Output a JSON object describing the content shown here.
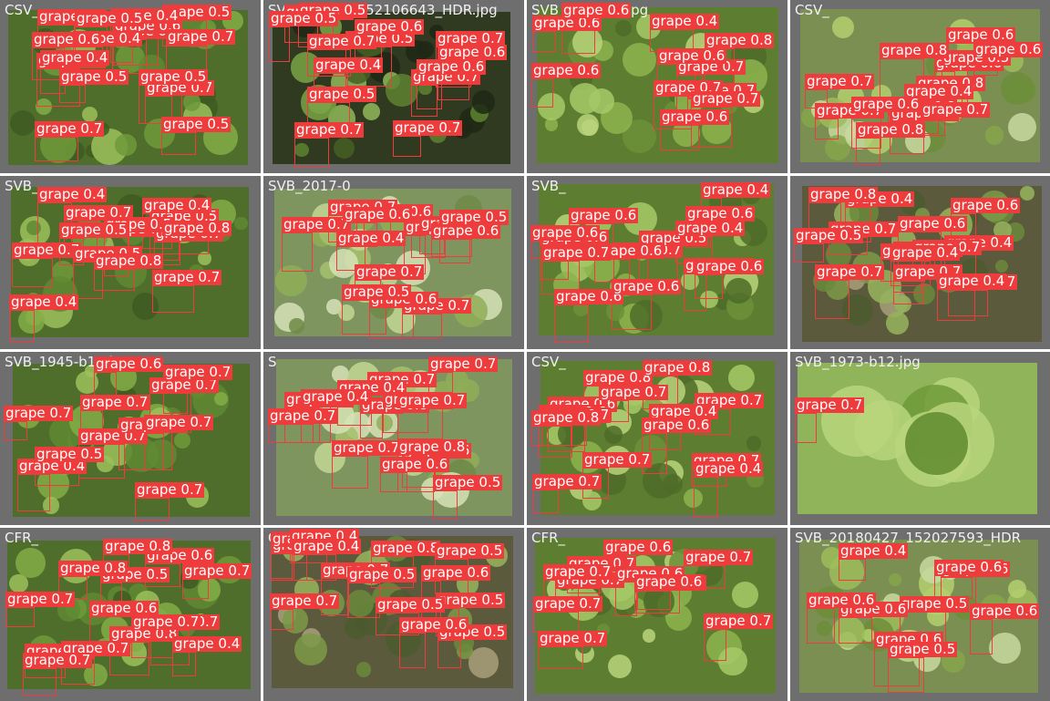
{
  "image": {
    "kind": "object-detection-mosaic",
    "class_name": "grape"
  },
  "palette": {
    "box": "#ee3b3b",
    "tag_text": "#ffffff",
    "tile_bg": "#6e6e6e",
    "file_label": "#f0f0f0"
  },
  "tiles": [
    {
      "file": "CSV_",
      "scene": "leaf-grapes",
      "detections": [
        {
          "label": "grape",
          "conf": "0.5"
        },
        {
          "label": "grape",
          "conf": "0.7"
        },
        {
          "label": "grape",
          "conf": "0.7"
        },
        {
          "label": "grape",
          "conf": "0.6"
        },
        {
          "label": "grape",
          "conf": "0.8"
        },
        {
          "label": "grape",
          "conf": "0.4"
        },
        {
          "label": "grape",
          "conf": "0.7"
        },
        {
          "label": "grape",
          "conf": "0.5"
        },
        {
          "label": "grape",
          "conf": "0.4"
        },
        {
          "label": "grape",
          "conf": "0.7"
        },
        {
          "label": "grape",
          "conf": "0.5"
        },
        {
          "label": "grape",
          "conf": "0.7"
        },
        {
          "label": "grape",
          "conf": "0.4"
        },
        {
          "label": "grape",
          "conf": "0.6"
        },
        {
          "label": "grape",
          "conf": "0.5"
        },
        {
          "label": "grape",
          "conf": "0.5"
        }
      ]
    },
    {
      "file": "SVB_2018..._152106643_HDR.jpg",
      "scene": "dark-vine",
      "detections": [
        {
          "label": "grape",
          "conf": "0.5"
        },
        {
          "label": "grape",
          "conf": "0.4"
        },
        {
          "label": "grape",
          "conf": "0.7"
        },
        {
          "label": "grape",
          "conf": "0.7"
        },
        {
          "label": "grape",
          "conf": "0.6"
        },
        {
          "label": "grape",
          "conf": "0.5"
        },
        {
          "label": "grape",
          "conf": "0.7"
        },
        {
          "label": "grape",
          "conf": "0.6"
        },
        {
          "label": "grape",
          "conf": "0.6"
        },
        {
          "label": "grape",
          "conf": "0.7"
        },
        {
          "label": "grape",
          "conf": "0.7"
        },
        {
          "label": "grape",
          "conf": "0.5"
        },
        {
          "label": "grape",
          "conf": "0.7"
        },
        {
          "label": "grape",
          "conf": "0.5"
        }
      ]
    },
    {
      "file": "SVB_1949-b6.jpg",
      "scene": "green-cluster",
      "detections": [
        {
          "label": "grape",
          "conf": "0.6"
        },
        {
          "label": "grape",
          "conf": "0.7"
        },
        {
          "label": "grape",
          "conf": "0.6"
        },
        {
          "label": "grape",
          "conf": "0.7"
        },
        {
          "label": "grape",
          "conf": "0.6"
        },
        {
          "label": "grape",
          "conf": "0.7"
        },
        {
          "label": "grape",
          "conf": "0.7"
        },
        {
          "label": "grape",
          "conf": "0.4"
        },
        {
          "label": "grape",
          "conf": "0.6"
        },
        {
          "label": "grape",
          "conf": "0.8"
        },
        {
          "label": "grape",
          "conf": "0.6"
        }
      ]
    },
    {
      "file": "CSV_",
      "scene": "dense-bunch",
      "detections": [
        {
          "label": "grape",
          "conf": "0.8"
        },
        {
          "label": "grape",
          "conf": "0.7"
        },
        {
          "label": "grape",
          "conf": "0.6"
        },
        {
          "label": "grape",
          "conf": "0.6"
        },
        {
          "label": "grape",
          "conf": "0.7"
        },
        {
          "label": "grape",
          "conf": "0.8"
        },
        {
          "label": "grape",
          "conf": "0.5"
        },
        {
          "label": "grape",
          "conf": "0.4"
        },
        {
          "label": "grape",
          "conf": "0.8"
        },
        {
          "label": "grape",
          "conf": "0.6"
        },
        {
          "label": "grape",
          "conf": "0.7"
        },
        {
          "label": "grape",
          "conf": "0.8"
        },
        {
          "label": "grape",
          "conf": "0.6"
        },
        {
          "label": "grape",
          "conf": "0.7"
        }
      ]
    },
    {
      "file": "SVB_",
      "scene": "leaf-grapes",
      "detections": [
        {
          "label": "grape",
          "conf": "0.4"
        },
        {
          "label": "grape",
          "conf": "0.4"
        },
        {
          "label": "grape",
          "conf": "0.5"
        },
        {
          "label": "grape",
          "conf": "0.4"
        },
        {
          "label": "grape",
          "conf": "0.7"
        },
        {
          "label": "grape",
          "conf": "0.7"
        },
        {
          "label": "grape",
          "conf": "0.7"
        },
        {
          "label": "grape",
          "conf": "0.5"
        },
        {
          "label": "grape",
          "conf": "0.5"
        },
        {
          "label": "grape",
          "conf": "0.8"
        },
        {
          "label": "grape",
          "conf": "0.7"
        },
        {
          "label": "grape",
          "conf": "0.5"
        },
        {
          "label": "grape",
          "conf": "0.7"
        },
        {
          "label": "grape",
          "conf": "0.8"
        }
      ]
    },
    {
      "file": "SVB_2017-0",
      "scene": "pale-bunch",
      "detections": [
        {
          "label": "grape",
          "conf": "0.6"
        },
        {
          "label": "grape",
          "conf": "0.7"
        },
        {
          "label": "grape",
          "conf": "0.6"
        },
        {
          "label": "grape",
          "conf": "0.7"
        },
        {
          "label": "grape",
          "conf": "0.6"
        },
        {
          "label": "grape",
          "conf": "0.7"
        },
        {
          "label": "grape",
          "conf": "0.7"
        },
        {
          "label": "grape",
          "conf": "0.5"
        },
        {
          "label": "grape",
          "conf": "0.7"
        },
        {
          "label": "grape",
          "conf": "0.6"
        },
        {
          "label": "grape",
          "conf": "0.5"
        },
        {
          "label": "grape",
          "conf": "0.6"
        },
        {
          "label": "grape",
          "conf": "0.7"
        },
        {
          "label": "grape",
          "conf": "0.4"
        }
      ]
    },
    {
      "file": "SVB_",
      "scene": "green-cluster",
      "detections": [
        {
          "label": "grape",
          "conf": "0.6"
        },
        {
          "label": "grape",
          "conf": "0.7"
        },
        {
          "label": "grape",
          "conf": "0.5"
        },
        {
          "label": "grape",
          "conf": "0.6"
        },
        {
          "label": "grape",
          "conf": "0.6"
        },
        {
          "label": "grape",
          "conf": "0.6"
        },
        {
          "label": "grape",
          "conf": "0.6"
        },
        {
          "label": "grape",
          "conf": "0.6"
        },
        {
          "label": "grape",
          "conf": "0.4"
        },
        {
          "label": "grape",
          "conf": "0.6"
        },
        {
          "label": "grape",
          "conf": "0.4"
        },
        {
          "label": "grape",
          "conf": "0.6"
        },
        {
          "label": "grape",
          "conf": "0.7"
        },
        {
          "label": "grape",
          "conf": "0.6"
        }
      ]
    },
    {
      "file": "",
      "scene": "soil-grapes",
      "detections": [
        {
          "label": "grape",
          "conf": "0.7"
        },
        {
          "label": "grape",
          "conf": "0.7"
        },
        {
          "label": "grape",
          "conf": "0.7"
        },
        {
          "label": "grape",
          "conf": "0.4"
        },
        {
          "label": "grape",
          "conf": "0.7"
        },
        {
          "label": "grape",
          "conf": "0.7"
        },
        {
          "label": "grape",
          "conf": "0.6"
        },
        {
          "label": "grape",
          "conf": "0.4"
        },
        {
          "label": "grape",
          "conf": "0.6"
        },
        {
          "label": "grape",
          "conf": "0.5"
        },
        {
          "label": "grape",
          "conf": "0.4"
        },
        {
          "label": "grape",
          "conf": "0.6"
        },
        {
          "label": "grape",
          "conf": "0.7"
        },
        {
          "label": "grape",
          "conf": "0.8"
        },
        {
          "label": "grape",
          "conf": "0.4"
        }
      ]
    },
    {
      "file": "SVB_1945-b13.jpg",
      "scene": "leaf-grapes",
      "detections": [
        {
          "label": "grape",
          "conf": "0.4"
        },
        {
          "label": "grape",
          "conf": "0.7"
        },
        {
          "label": "grape",
          "conf": "0.7"
        },
        {
          "label": "grape",
          "conf": "0.7"
        },
        {
          "label": "grape",
          "conf": "0.6"
        },
        {
          "label": "grape",
          "conf": "0.6"
        },
        {
          "label": "grape",
          "conf": "0.7"
        },
        {
          "label": "grape",
          "conf": "0.5"
        },
        {
          "label": "grape",
          "conf": "0.7"
        },
        {
          "label": "grape",
          "conf": "0.7"
        },
        {
          "label": "grape",
          "conf": "0.7"
        }
      ]
    },
    {
      "file": "S",
      "scene": "pale-bunch",
      "detections": [
        {
          "label": "grape",
          "conf": "0.7"
        },
        {
          "label": "grape",
          "conf": "0.4"
        },
        {
          "label": "grape",
          "conf": "0.7"
        },
        {
          "label": "grape",
          "conf": "0.5"
        },
        {
          "label": "grape",
          "conf": "0.6"
        },
        {
          "label": "grape",
          "conf": "0.8"
        },
        {
          "label": "grape",
          "conf": "0.7"
        },
        {
          "label": "grape",
          "conf": "0.7"
        },
        {
          "label": "grape",
          "conf": "0.4"
        },
        {
          "label": "grape",
          "conf": "0.7"
        },
        {
          "label": "grape",
          "conf": "0.5"
        },
        {
          "label": "grape",
          "conf": "0.6"
        },
        {
          "label": "grape",
          "conf": "0.7"
        },
        {
          "label": "grape",
          "conf": "0.8"
        }
      ]
    },
    {
      "file": "CSV_",
      "scene": "green-cluster",
      "detections": [
        {
          "label": "grape",
          "conf": "0.6"
        },
        {
          "label": "grape",
          "conf": "0.6"
        },
        {
          "label": "grape",
          "conf": "0.7"
        },
        {
          "label": "grape",
          "conf": "0.7"
        },
        {
          "label": "grape",
          "conf": "0.7"
        },
        {
          "label": "grape",
          "conf": "0.8"
        },
        {
          "label": "grape",
          "conf": "0.4"
        },
        {
          "label": "grape",
          "conf": "0.7"
        },
        {
          "label": "grape",
          "conf": "0.7"
        },
        {
          "label": "grape",
          "conf": "0.8"
        },
        {
          "label": "grape",
          "conf": "0.8"
        },
        {
          "label": "grape",
          "conf": "0.4"
        },
        {
          "label": "grape",
          "conf": "0.7"
        },
        {
          "label": "grape",
          "conf": "0.6"
        }
      ]
    },
    {
      "file": "SVB_1973-b12.jpg",
      "scene": "closeup",
      "detections": [
        {
          "label": "grape",
          "conf": "0.7"
        }
      ]
    },
    {
      "file": "CFR_",
      "scene": "leaf-grapes",
      "detections": [
        {
          "label": "grape",
          "conf": "0.8"
        },
        {
          "label": "grape",
          "conf": "0.7"
        },
        {
          "label": "grape",
          "conf": "0.7"
        },
        {
          "label": "grape",
          "conf": "0.7"
        },
        {
          "label": "grape",
          "conf": "0.8"
        },
        {
          "label": "grape",
          "conf": "0.7"
        },
        {
          "label": "grape",
          "conf": "0.4"
        },
        {
          "label": "grape",
          "conf": "0.6"
        },
        {
          "label": "grape",
          "conf": "0.5"
        },
        {
          "label": "grape",
          "conf": "0.7"
        },
        {
          "label": "grape",
          "conf": "0.6"
        },
        {
          "label": "grape",
          "conf": "0.7"
        },
        {
          "label": "grape",
          "conf": "0.8"
        },
        {
          "label": "grape",
          "conf": "0.8"
        }
      ]
    },
    {
      "file": "CSV_",
      "scene": "soil-grapes",
      "detections": [
        {
          "label": "grape",
          "conf": "0.8"
        },
        {
          "label": "grape",
          "conf": "0.5"
        },
        {
          "label": "grape",
          "conf": "0.4"
        },
        {
          "label": "grape",
          "conf": "0.6"
        },
        {
          "label": "grape",
          "conf": "0.5"
        },
        {
          "label": "grape",
          "conf": "0.5"
        },
        {
          "label": "grape",
          "conf": "0.5"
        },
        {
          "label": "grape",
          "conf": "0.6"
        },
        {
          "label": "grape",
          "conf": "0.7"
        },
        {
          "label": "grape",
          "conf": "0.7"
        },
        {
          "label": "grape",
          "conf": "0.5"
        },
        {
          "label": "grape",
          "conf": "0.6"
        },
        {
          "label": "grape",
          "conf": "0.4"
        },
        {
          "label": "grape",
          "conf": "0.4"
        }
      ]
    },
    {
      "file": "CFR_",
      "scene": "green-cluster",
      "detections": [
        {
          "label": "grape",
          "conf": "0.7"
        },
        {
          "label": "grape",
          "conf": "0.7"
        },
        {
          "label": "grape",
          "conf": "0.7"
        },
        {
          "label": "grape",
          "conf": "0.7"
        },
        {
          "label": "grape",
          "conf": "0.7"
        },
        {
          "label": "grape",
          "conf": "0.6"
        },
        {
          "label": "grape",
          "conf": "0.7"
        },
        {
          "label": "grape",
          "conf": "0.6"
        },
        {
          "label": "grape",
          "conf": "0.7"
        },
        {
          "label": "grape",
          "conf": "0.7"
        },
        {
          "label": "grape",
          "conf": "0.6"
        }
      ]
    },
    {
      "file": "SVB_20180427_152027593_HDR",
      "scene": "dense-bunch",
      "detections": [
        {
          "label": "grape",
          "conf": "0.5"
        },
        {
          "label": "grape",
          "conf": "0.6"
        },
        {
          "label": "grape",
          "conf": "0.6"
        },
        {
          "label": "grape",
          "conf": "0.6"
        },
        {
          "label": "grape",
          "conf": "0.6"
        },
        {
          "label": "grape",
          "conf": "0.4"
        },
        {
          "label": "grape",
          "conf": "0.6"
        },
        {
          "label": "grape",
          "conf": "0.5"
        },
        {
          "label": "grape",
          "conf": "0.6"
        }
      ]
    }
  ]
}
